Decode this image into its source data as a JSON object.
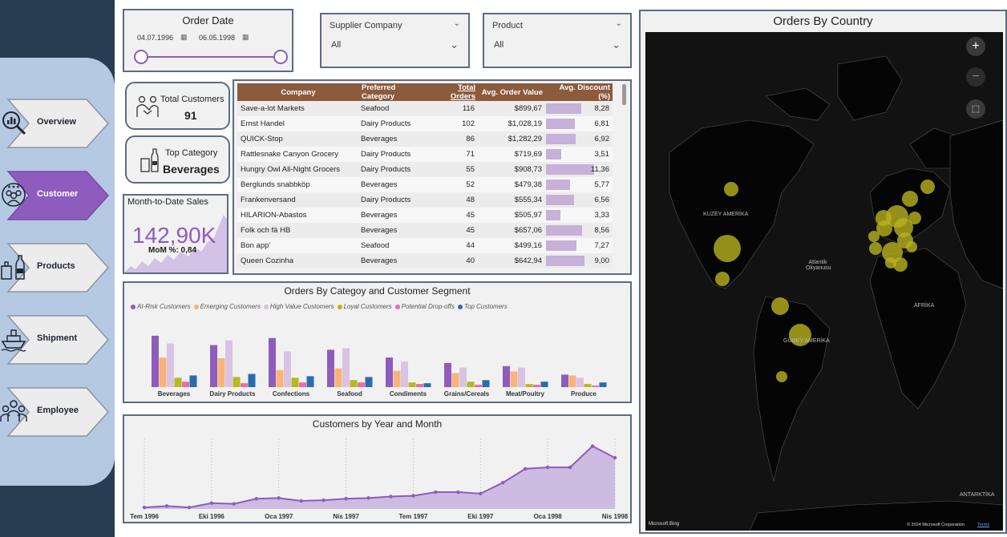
{
  "nav": {
    "items": [
      {
        "label": "Overview",
        "icon": "analytics-search-icon",
        "active": false
      },
      {
        "label": "Customer",
        "icon": "customers-group-icon",
        "active": true
      },
      {
        "label": "Products",
        "icon": "products-bottles-icon",
        "active": false
      },
      {
        "label": "Shipment",
        "icon": "ship-icon",
        "active": false
      },
      {
        "label": "Employee",
        "icon": "employees-icon",
        "active": false
      }
    ]
  },
  "order_date": {
    "title": "Order Date",
    "from": "04.07.1996",
    "to": "06.05.1998"
  },
  "supplier_slicer": {
    "label": "Supplier Company",
    "value": "All"
  },
  "product_slicer": {
    "label": "Product",
    "value": "All"
  },
  "kpi": {
    "total_customers_label": "Total Customers",
    "total_customers_value": "91",
    "top_category_label": "Top Category",
    "top_category_value": "Beverages",
    "mtd_label": "Month-to-Date Sales",
    "mtd_value": "142,90K",
    "mom_text": "MoM %: 0,84"
  },
  "table": {
    "columns": [
      "Company",
      "Preferred Category",
      "Total Orders",
      "Avg. Order Value",
      "Avg. Discount (%)"
    ],
    "rows": [
      [
        "Save-a-lot Markets",
        "Seafood",
        "116",
        "$899,67",
        "8,28"
      ],
      [
        "Ernst Handel",
        "Dairy Products",
        "102",
        "$1,028,19",
        "6,81"
      ],
      [
        "QUICK-Stop",
        "Beverages",
        "86",
        "$1,282,29",
        "6,92"
      ],
      [
        "Rattlesnake Canyon Grocery",
        "Dairy Products",
        "71",
        "$719,69",
        "3,51"
      ],
      [
        "Hungry Owl All-Night Grocers",
        "Dairy Products",
        "55",
        "$908,73",
        "11,36"
      ],
      [
        "Berglunds snabbköp",
        "Beverages",
        "52",
        "$479,38",
        "5,77"
      ],
      [
        "Frankenversand",
        "Dairy Products",
        "48",
        "$555,34",
        "6,56"
      ],
      [
        "HILARION-Abastos",
        "Beverages",
        "45",
        "$505,97",
        "3,33"
      ],
      [
        "Folk och fä HB",
        "Beverages",
        "45",
        "$657,06",
        "8,56"
      ],
      [
        "Bon app'",
        "Seafood",
        "44",
        "$499,16",
        "7,27"
      ],
      [
        "Queen Cozinha",
        "Beverages",
        "40",
        "$642,94",
        "9,00"
      ]
    ]
  },
  "charts": {
    "category_segment": {
      "type": "bar",
      "title": "Orders By Categoy and Customer Segment",
      "categories": [
        "Beverages",
        "Dairy Products",
        "Confections",
        "Seafood",
        "Condiments",
        "Grains/Cereals",
        "Meat/Poultry",
        "Produce"
      ],
      "series": [
        {
          "name": "At-Risk Customers",
          "color": "#8e5cbd",
          "values": [
            66,
            54,
            63,
            48,
            38,
            31,
            27,
            16
          ]
        },
        {
          "name": "Emerging Customers",
          "color": "#f9b37a",
          "values": [
            38,
            37,
            22,
            24,
            21,
            18,
            20,
            15
          ]
        },
        {
          "name": "High Value Customers",
          "color": "#d9c3e3",
          "values": [
            56,
            60,
            46,
            50,
            33,
            25,
            25,
            12
          ]
        },
        {
          "name": "Loyal Customers",
          "color": "#b3ba1a",
          "values": [
            12,
            13,
            12,
            9,
            6,
            7,
            4,
            4
          ]
        },
        {
          "name": "Potential Drop-offs",
          "color": "#ef6aa8",
          "values": [
            7,
            5,
            6,
            6,
            4,
            3,
            3,
            2
          ]
        },
        {
          "name": "Top Customers",
          "color": "#2b6cb0",
          "values": [
            15,
            17,
            14,
            13,
            5,
            9,
            7,
            6
          ]
        }
      ]
    },
    "customers_by_month": {
      "type": "area",
      "title": "Customers by Year and Month",
      "x_ticks": [
        "Tem 1996",
        "Eki 1996",
        "Oca 1997",
        "Nis 1997",
        "Tem 1997",
        "Eki 1997",
        "Oca 1998",
        "Nis 1998"
      ],
      "values": [
        2,
        4,
        2,
        8,
        7,
        14,
        15,
        11,
        12,
        14,
        15,
        17,
        18,
        23,
        23,
        21,
        36,
        55,
        57,
        57,
        86,
        70
      ],
      "ylim": [
        0,
        90
      ]
    },
    "orders_by_country": {
      "title": "Orders By Country",
      "map_labels": [
        "KUZEY AMERİKA",
        "GÜNEY AMERİKA",
        "AFRİKA",
        "Atlantik Okyanusu",
        "ANTARKTİKA"
      ],
      "attribution_left": "Microsoft Bing",
      "attribution_right": "© 2024 Microsoft Corporation",
      "terms": "Terms"
    }
  },
  "colors": {
    "nav_bg": "#283d52",
    "nav_panel": "#b6c9e2",
    "active_nav": "#8e5cbd",
    "table_header": "#8c5a3c",
    "accent_purple": "#8e5cbd",
    "bubble": "#b8b21e"
  }
}
